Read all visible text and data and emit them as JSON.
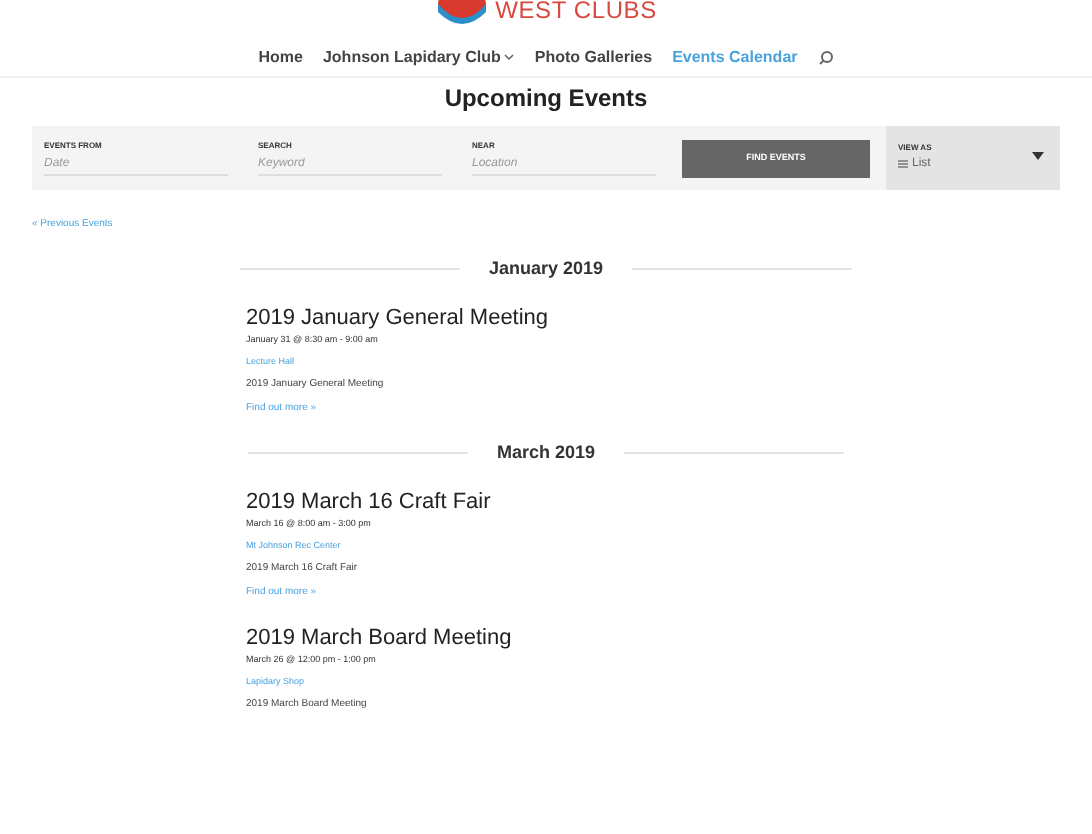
{
  "logo": {
    "text": "WEST CLUBS"
  },
  "nav": [
    {
      "label": "Home",
      "selected": false,
      "dropdown": false
    },
    {
      "label": "Johnson Lapidary Club",
      "selected": false,
      "dropdown": true
    },
    {
      "label": "Photo Galleries",
      "selected": false,
      "dropdown": false
    },
    {
      "label": "Events Calendar",
      "selected": true,
      "dropdown": false
    }
  ],
  "title": "Upcoming Events",
  "filters": [
    {
      "label": "EVENTS FROM",
      "placeholder": "Date"
    },
    {
      "label": "SEARCH",
      "placeholder": "Keyword"
    },
    {
      "label": "NEAR",
      "placeholder": "Location"
    }
  ],
  "find_button": "FIND EVENTS",
  "view": {
    "label": "VIEW AS",
    "value": "List"
  },
  "previous_link": "« Previous Events",
  "months": [
    {
      "heading": "January 2019",
      "events": [
        {
          "title": "2019 January General Meeting",
          "when": "January 31 @ 8:30 am - 9:00 am",
          "venue": "Lecture Hall",
          "description": "2019 January General Meeting",
          "more": "Find out more »"
        }
      ]
    },
    {
      "heading": "March 2019",
      "events": [
        {
          "title": "2019 March 16 Craft Fair",
          "when": "March 16 @ 8:00 am - 3:00 pm",
          "venue": "Mt Johnson Rec Center",
          "description": "2019 March 16 Craft Fair",
          "more": "Find out more »"
        },
        {
          "title": "2019 March Board Meeting",
          "when": "March 26 @ 12:00 pm - 1:00 pm",
          "venue": "Lapidary Shop",
          "description": "2019 March Board Meeting"
        }
      ]
    }
  ]
}
